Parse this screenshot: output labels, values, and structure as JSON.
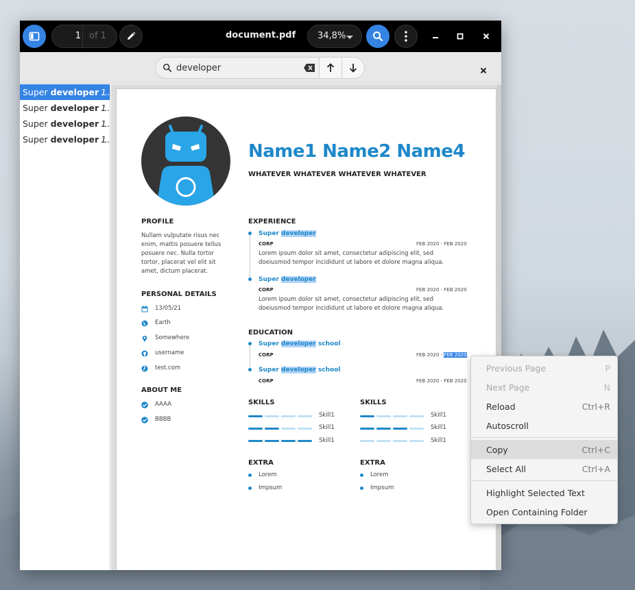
{
  "toolbar": {
    "page_current": "1",
    "page_of": "of 1",
    "title": "document.pdf",
    "zoom": "34,8%"
  },
  "search": {
    "query": "developer"
  },
  "sidebar": {
    "results": [
      {
        "prefix": "Super ",
        "match": "developer",
        "rest": " ...",
        "page": "1"
      },
      {
        "prefix": "Super ",
        "match": "developer",
        "rest": " ...",
        "page": "1"
      },
      {
        "prefix": "Super ",
        "match": "developer",
        "rest": " ...",
        "page": "1"
      },
      {
        "prefix": "Super ",
        "match": "developer",
        "rest": " ...",
        "page": "1"
      }
    ]
  },
  "resume": {
    "name": "Name1 Name2 Name4",
    "subtitle": "WHATEVER WHATEVER WHATEVER WHATEVER",
    "profile_heading": "PROFILE",
    "profile_lines": [
      "Nullam vulputate risus nec",
      "enim, mattis posuere tellus",
      "posuere nec. Nulla tortor",
      "tortor, placerat vel elit sit",
      "amet, dictum placerat."
    ],
    "personal_heading": "PERSONAL DETAILS",
    "personal": [
      "13/05/21",
      "Earth",
      "Somewhere",
      "username",
      "test.com"
    ],
    "about_heading": "ABOUT ME",
    "about": [
      "AAAA",
      "BBBB"
    ],
    "experience_heading": "EXPERIENCE",
    "exp_title_prefix": "Super ",
    "exp_title_match": "developer",
    "corp": "CORP",
    "dates": "FEB 2020 - FEB 2020",
    "exp_line1": "Lorem ipsum dolor sit amet, consectetur adipiscing elit, sed",
    "exp_line2": "doeiusmod tempor incididunt ut labore et dolore magna aliqua.",
    "education_heading": "EDUCATION",
    "edu_suffix": " school",
    "edu_dates_prefix": "FEB 2020 - ",
    "edu_dates_sel": "FEB 2020",
    "skills_heading": "SKILLS",
    "skill_label": "Skill1",
    "extra_heading": "EXTRA",
    "extra": [
      "Lorem",
      "Impsum"
    ]
  },
  "context_menu": {
    "items": [
      {
        "label": "Previous Page",
        "accel": "P"
      },
      {
        "label": "Next Page",
        "accel": "N"
      },
      {
        "label": "Reload",
        "accel": "Ctrl+R"
      },
      {
        "label": "Autoscroll",
        "accel": ""
      },
      {
        "label": "Copy",
        "accel": "Ctrl+C"
      },
      {
        "label": "Select All",
        "accel": "Ctrl+A"
      },
      {
        "label": "Highlight Selected Text",
        "accel": ""
      },
      {
        "label": "Open Containing Folder",
        "accel": ""
      }
    ]
  },
  "colors": {
    "accent": "#3584e4",
    "resume_blue": "#1e88c9",
    "titlebar": "#000000"
  },
  "icons": {
    "sidebar_toggle": "sidebar-icon",
    "edit": "pencil-icon",
    "search": "search-icon",
    "menu": "kebab-menu-icon",
    "clear": "backspace-clear-icon"
  }
}
